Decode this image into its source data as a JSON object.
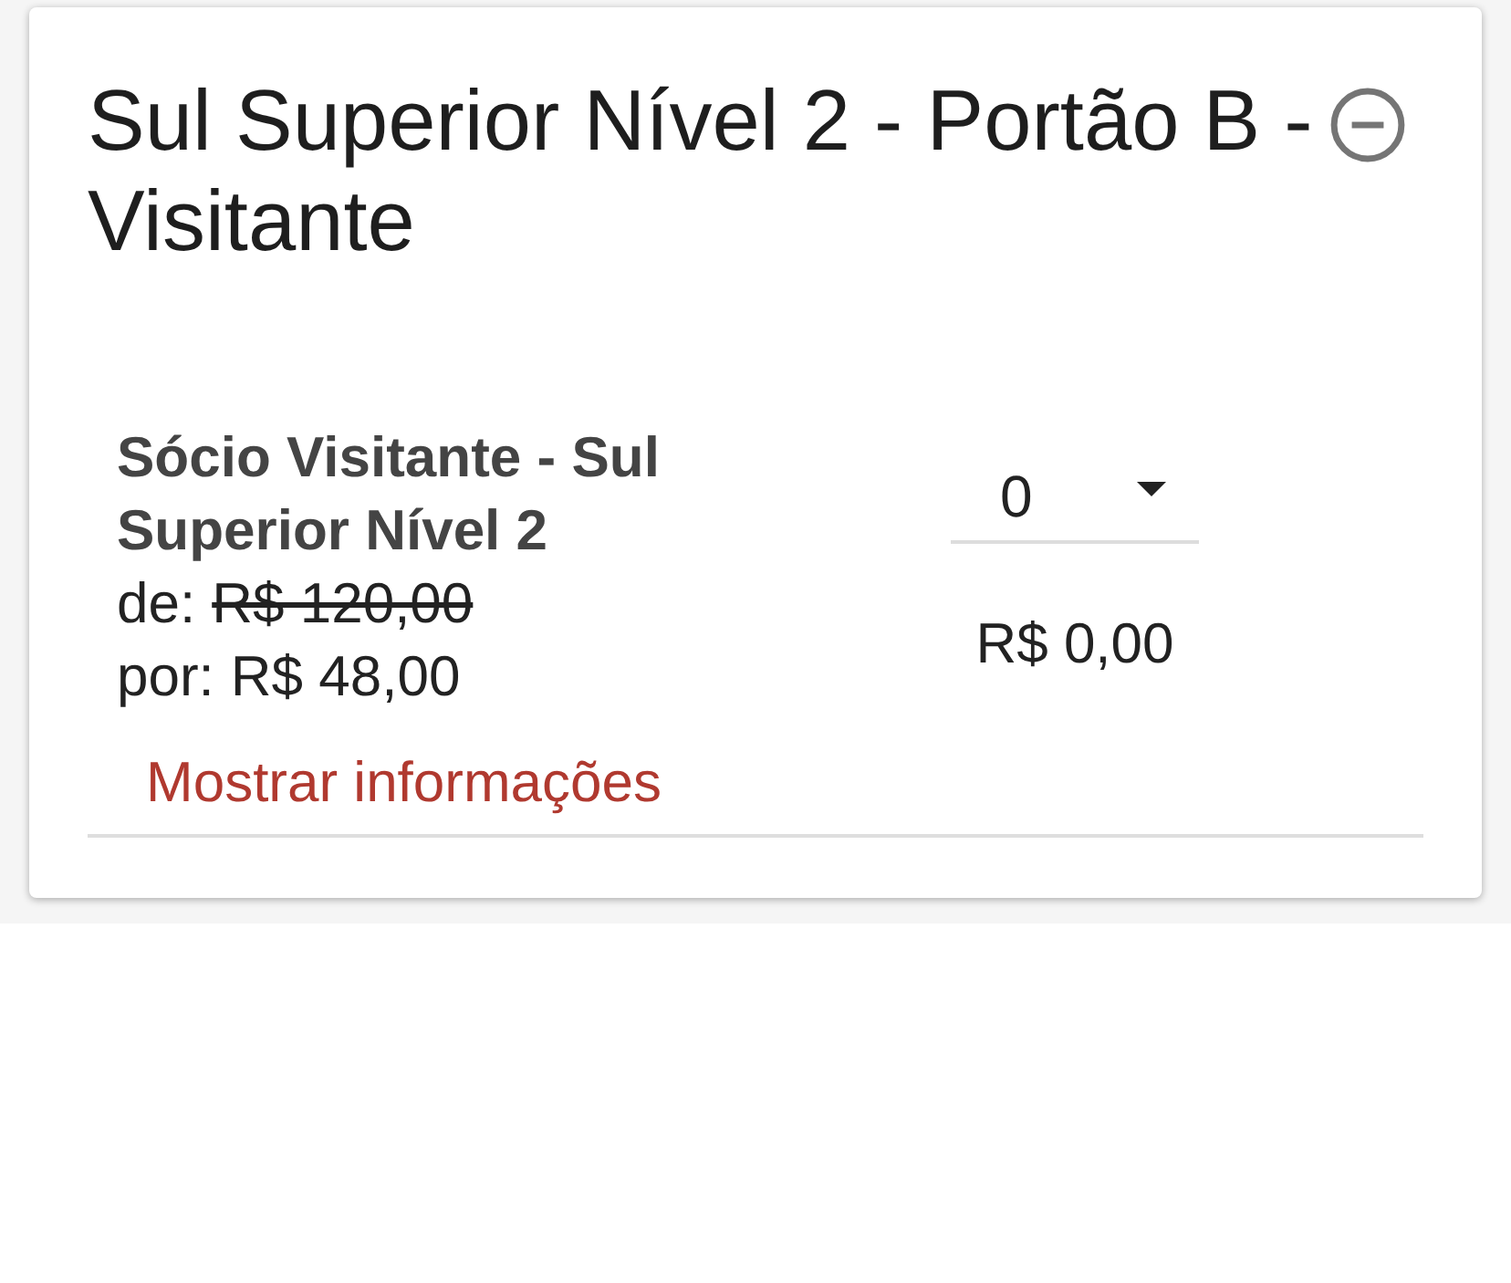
{
  "section": {
    "title": "Sul Superior Nível 2 - Portão B - Visitante",
    "expanded": true
  },
  "tickets": [
    {
      "name": "Sócio Visitante - Sul Superior Nível 2",
      "old_price_label": "de:",
      "old_price": "R$ 120,00",
      "price_label": "por:",
      "price": "R$ 48,00",
      "info_link": "Mostrar informações",
      "quantity": "0",
      "subtotal": "R$ 0,00"
    }
  ]
}
